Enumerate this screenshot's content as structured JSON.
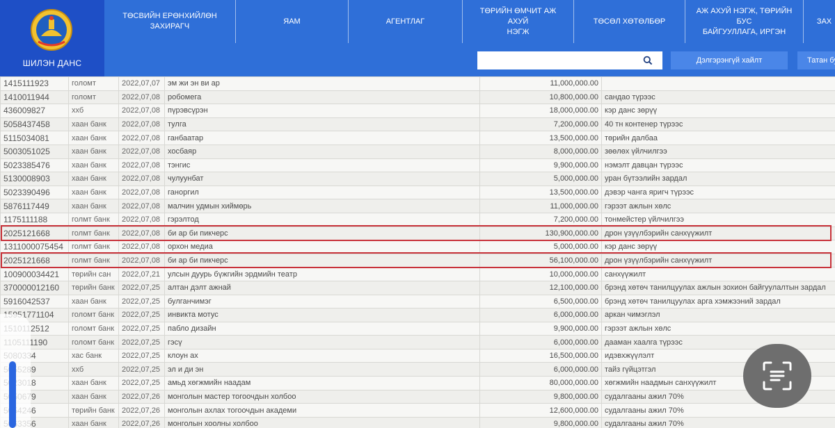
{
  "header": {
    "site_title": "ШИЛЭН ДАНС",
    "nav": [
      {
        "label": "ТӨСВИЙН ЕРӨНХИЙЛӨН\nЗАХИРАГЧ",
        "width": 188
      },
      {
        "label": "ЯАМ",
        "width": 162
      },
      {
        "label": "АГЕНТЛАГ",
        "width": 164
      },
      {
        "label": "ТӨРИЙН ӨМЧИТ АЖ АХУЙ\nНЭГЖ",
        "width": 160
      },
      {
        "label": "ТӨСӨЛ ХӨТӨЛБӨР",
        "width": 160
      },
      {
        "label": "АЖ АХУЙ НЭГЖ, ТӨРИЙН БУС\nБАЙГУУЛЛАГА, ИРГЭН",
        "width": 170
      },
      {
        "label": "ЗАХ",
        "width": 60
      }
    ],
    "search_placeholder": "",
    "advanced_search_label": "Дэлгэрэнгүй хайлт",
    "more_button_label": "Татан бу"
  },
  "table": {
    "rows": [
      [
        "1415111923",
        "голомт",
        "2022,07,07",
        "эм жи эн ви ар",
        "11,000,000.00",
        ""
      ],
      [
        "1410011944",
        "голомт",
        "2022,07,08",
        "робомега",
        "10,800,000.00",
        "сандао түрээс"
      ],
      [
        "436009827",
        "ххб",
        "2022,07,08",
        "пүрэвсүрэн",
        "18,000,000.00",
        "кэр данс зөрүү"
      ],
      [
        "5058437458",
        "хаан банк",
        "2022,07,08",
        "тулга",
        "7,200,000.00",
        "40 тн контенер түрээс"
      ],
      [
        "5115034081",
        "хаан банк",
        "2022,07,08",
        "ганбаатар",
        "13,500,000.00",
        "төрийн далбаа"
      ],
      [
        "5003051025",
        "хаан банк",
        "2022,07,08",
        "хосбаяр",
        "8,000,000.00",
        "зөөлөх үйлчилгээ"
      ],
      [
        "5023385476",
        "хаан банк",
        "2022,07,08",
        "тэнгис",
        "9,900,000.00",
        "нэмэлт давцан түрээс"
      ],
      [
        "5130008903",
        "хаан банк",
        "2022,07,08",
        "чулуунбат",
        "5,000,000.00",
        "уран бүтээлийн зардал"
      ],
      [
        "5023390496",
        "хаан банк",
        "2022,07,08",
        "ганоргил",
        "13,500,000.00",
        "дэвэр чанга яригч түрээс"
      ],
      [
        "5876117449",
        "хаан банк",
        "2022,07,08",
        "малчин удмын хиймөрь",
        "11,000,000.00",
        "гэрээт ажлын хөлс"
      ],
      [
        "1175111188",
        "голмт банк",
        "2022,07,08",
        "гэрэлтод",
        "7,200,000.00",
        "тонмейстер үйлчилгээ"
      ],
      [
        "2025121668",
        "голмт банк",
        "2022,07,08",
        "би ар би пикчерс",
        "130,900,000.00",
        "дрон үзүүлбэрийн санхүүжилт"
      ],
      [
        "1311000075454",
        "голмт банк",
        "2022,07,08",
        "орхон медиа",
        "5,000,000.00",
        "кэр данс зөрүү"
      ],
      [
        "2025121668",
        "голмт банк",
        "2022,07,08",
        "би ар би пикчерс",
        "56,100,000.00",
        "дрон үзүүлбэрийн санхүүжилт"
      ],
      [
        "100900034421",
        "төрийн сан",
        "2022,07,21",
        "улсын дуурь бүжгийн эрдмийн театр",
        "10,000,000.00",
        "санхүүжилт"
      ],
      [
        "370000012160",
        "төрийн банк",
        "2022,07,25",
        "алтан дэлт ажнай",
        "12,100,000.00",
        "брэнд хөтөч танилцуулах ажлын зохион байгуулалтын зардал"
      ],
      [
        "5916042537",
        "хаан банк",
        "2022,07,25",
        "булганчимэг",
        "6,500,000.00",
        "брэнд хөтөч танилцуулах арга хэмжээний зардал"
      ],
      [
        "15951771104",
        "голомт банк",
        "2022,07,25",
        "инвикта мотус",
        "6,000,000.00",
        "аркан чимэглэл"
      ],
      [
        "1510112512",
        "голомт банк",
        "2022,07,25",
        "пабло дизайн",
        "9,900,000.00",
        "гэрээт ажлын хөлс"
      ],
      [
        "1105111190",
        "голомт банк",
        "2022,07,25",
        "гэсү",
        "6,000,000.00",
        "дааман хаалга түрээс"
      ],
      [
        "5080334",
        "хас банк",
        "2022,07,25",
        "клоун ах",
        "16,500,000.00",
        "идэвхжүүлэлт"
      ],
      [
        "5055289",
        "ххб",
        "2022,07,25",
        "эл и ди эн",
        "6,000,000.00",
        "тайз гүйцэтгэл"
      ],
      [
        "5023018",
        "хаан банк",
        "2022,07,25",
        "амьд хөгжмийн наадам",
        "80,000,000.00",
        "хөгжмийн наадмын санхүүжилт"
      ],
      [
        "5050679",
        "хаан банк",
        "2022,07,26",
        "монголын мастер тогоочдын холбоо",
        "9,800,000.00",
        "судалгааны ажил 70%"
      ],
      [
        "5054246",
        "төрийн банк",
        "2022,07,26",
        "монголын ахлах тогоочдын академи",
        "12,600,000.00",
        "судалгааны ажил 70%"
      ],
      [
        "5063356",
        "хаан банк",
        "2022,07,26",
        "монголын хоолны холбоо",
        "9,800,000.00",
        "судалгааны ажил 70%"
      ]
    ],
    "highlighted_rows": [
      11,
      13
    ]
  },
  "colors": {
    "header_blue": "#2f6fd8",
    "logo_blue": "#1e4fc6",
    "button_blue": "#4a86e8",
    "highlight_red": "#c8323a"
  },
  "icons": {
    "search": "search-icon",
    "emblem": "state-emblem-icon",
    "lens": "scan-text-icon"
  },
  "scroll": {
    "position": 0.62
  }
}
